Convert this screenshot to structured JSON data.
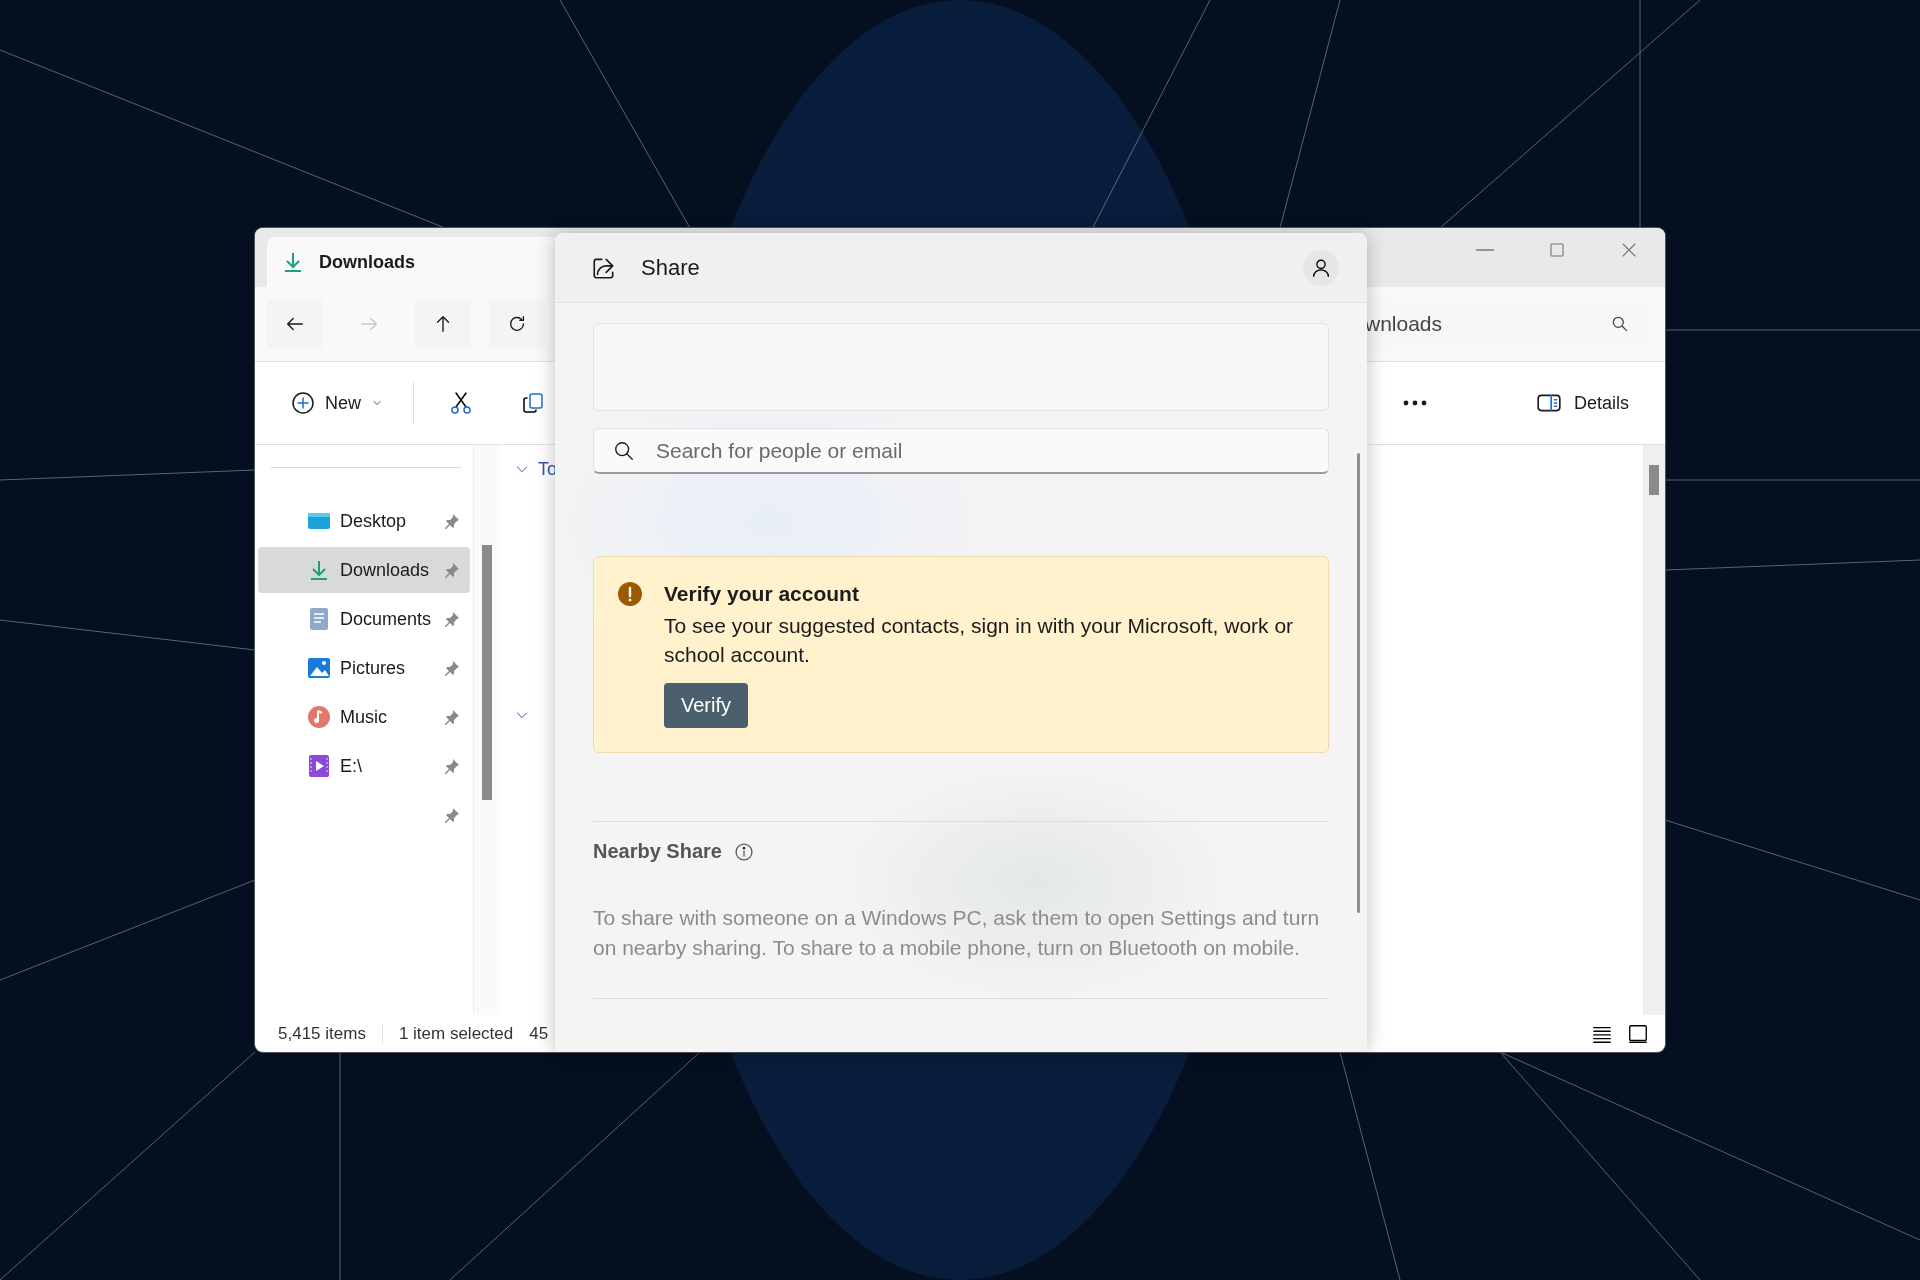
{
  "explorer": {
    "tab_title": "Downloads",
    "nav": [
      {
        "kind": "back",
        "disabled": false
      },
      {
        "kind": "forward",
        "disabled": true
      },
      {
        "kind": "up",
        "disabled": false
      },
      {
        "kind": "refresh",
        "disabled": false
      }
    ],
    "address_text": "wnloads",
    "toolbar": {
      "new_label": "New",
      "details_label": "Details"
    },
    "sidebar": [
      {
        "kind": "item",
        "label": "Desktop",
        "selected": false,
        "pinned": true
      },
      {
        "kind": "item",
        "label": "Downloads",
        "selected": true,
        "pinned": true
      },
      {
        "kind": "item",
        "label": "Documents",
        "selected": false,
        "pinned": true
      },
      {
        "kind": "item",
        "label": "Pictures",
        "selected": false,
        "pinned": true
      },
      {
        "kind": "item",
        "label": "Music",
        "selected": false,
        "pinned": true
      },
      {
        "kind": "item",
        "label": "E:\\",
        "selected": false,
        "pinned": true
      },
      {
        "kind": "blank",
        "selected": false,
        "pinned": true
      }
    ],
    "groups": [
      {
        "label": "To",
        "expanded": true
      },
      {
        "expanded": true
      }
    ],
    "status": [
      "5,415 items",
      "1 item selected",
      "45"
    ]
  },
  "share": {
    "title": "Share",
    "search": {
      "placeholder": "Search for people or email"
    },
    "notice": {
      "title": "Verify your account",
      "body": "To see your suggested contacts, sign in with your Microsoft, work or school account.",
      "button": "Verify"
    },
    "nearby": {
      "title": "Nearby Share",
      "body": "To share with someone on a Windows PC, ask them to open Settings and turn on nearby sharing. To share to a mobile phone, turn on Bluetooth on mobile."
    }
  }
}
